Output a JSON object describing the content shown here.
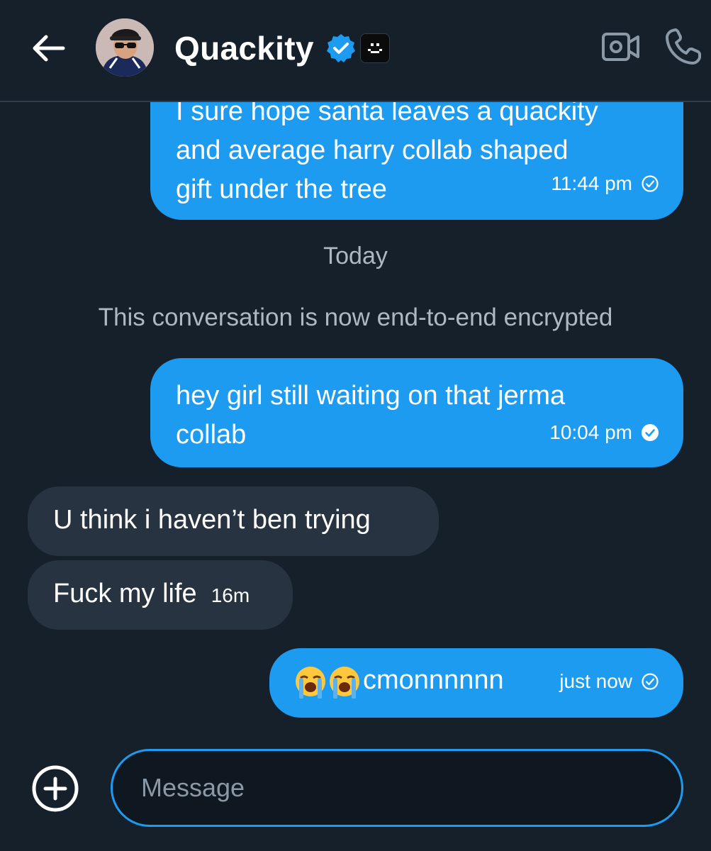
{
  "header": {
    "contact_name": "Quackity"
  },
  "messages": [
    {
      "id": "m1",
      "direction": "sent",
      "line1": "I sure hope santa leaves a quackity",
      "line2": "and average harry collab shaped",
      "line3": "gift under the tree",
      "time": "11:44 pm",
      "status": "sent"
    },
    {
      "id": "m2",
      "direction": "sent",
      "line1": "hey girl still waiting on that jerma",
      "line2": "collab",
      "time": "10:04 pm",
      "status": "read"
    },
    {
      "id": "m3",
      "direction": "received",
      "text": "U think i haven’t ben trying"
    },
    {
      "id": "m4",
      "direction": "received",
      "text": "Fuck my life",
      "time": "16m"
    },
    {
      "id": "m5",
      "direction": "sent",
      "emoji": "😭😭",
      "text": "cmonnnnnn",
      "time": "just now",
      "status": "sent"
    }
  ],
  "day_separator": "Today",
  "encryption_notice": "This conversation is now end-to-end encrypted",
  "composer": {
    "placeholder": "Message"
  },
  "colors": {
    "background": "#15202b",
    "sent_bubble": "#1d9bf0",
    "received_bubble": "#273340",
    "muted_text": "#aeb8c2",
    "accent": "#1d9bf0"
  },
  "icons": {
    "back": "arrow-left-icon",
    "verified": "verified-badge-icon",
    "affiliate": "affiliate-badge-icon",
    "video": "video-call-icon",
    "phone": "phone-icon",
    "add": "plus-circle-icon",
    "status_sent": "check-circle-outline-icon",
    "status_read": "check-circle-filled-icon"
  }
}
